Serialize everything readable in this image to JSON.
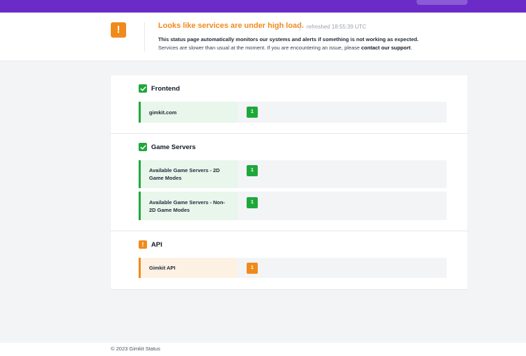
{
  "alert": {
    "title": "Looks like services are under high load.",
    "refreshed": "refreshed 18:55:39 UTC",
    "line1": "This status page automatically monitors our systems and alerts if something is not working as expected.",
    "line2_prefix": "Services are slower than usual at the moment. If you are encountering an issue, please ",
    "line2_link": "contact our support",
    "line2_suffix": ".",
    "icon": "exclamation-icon",
    "color": "#f08a1c"
  },
  "groups": [
    {
      "title": "Frontend",
      "status": "ok",
      "items": [
        {
          "label": "gimkit.com",
          "count": "1",
          "status": "ok"
        }
      ]
    },
    {
      "title": "Game Servers",
      "status": "ok",
      "items": [
        {
          "label": "Available Game Servers - 2D Game Modes",
          "count": "1",
          "status": "ok"
        },
        {
          "label": "Available Game Servers - Non-2D Game Modes",
          "count": "1",
          "status": "ok"
        }
      ]
    },
    {
      "title": "API",
      "status": "warning",
      "items": [
        {
          "label": "Gimkit API",
          "count": "1",
          "status": "warning"
        }
      ]
    }
  ],
  "colors": {
    "brand": "#6a2bc9",
    "ok": "#1fa83a",
    "warning": "#f08a1c"
  },
  "footer": {
    "text": "© 2023 Gimkit Status"
  }
}
